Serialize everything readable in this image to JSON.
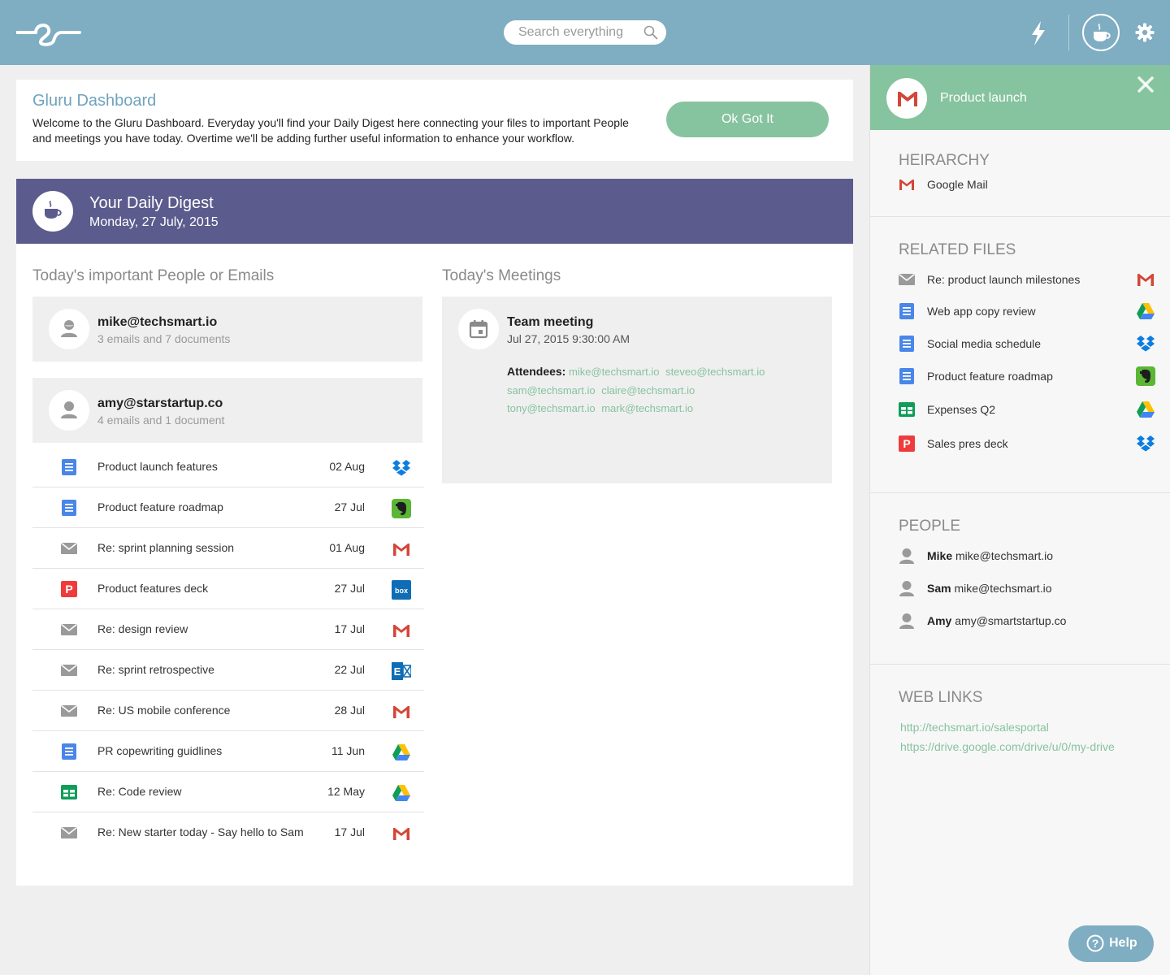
{
  "header": {
    "search_placeholder": "Search everything",
    "icons": [
      "logo-icon",
      "search-icon",
      "lightning-icon",
      "coffee-cup-icon",
      "gear-icon"
    ]
  },
  "welcome": {
    "title": "Gluru Dashboard",
    "text": "Welcome to the Gluru Dashboard. Everyday you'll find your Daily Digest here connecting your files to important People and meetings you have today. Overtime we'll be adding further useful information to enhance your workflow.",
    "button_label": "Ok Got It"
  },
  "digest": {
    "title": "Your Daily Digest",
    "date": "Monday, 27 July, 2015",
    "people_title": "Today's important People or Emails",
    "meetings_title": "Today's Meetings",
    "people": [
      {
        "email": "mike@techsmart.io",
        "summary": "3 emails and 7 documents"
      },
      {
        "email": "amy@starstartup.co",
        "summary": "4 emails and 1 document"
      }
    ],
    "files": [
      {
        "name": "Product launch features",
        "date": "02 Aug",
        "type": "doc",
        "source": "dropbox"
      },
      {
        "name": "Product feature roadmap",
        "date": "27 Jul",
        "type": "doc",
        "source": "evernote"
      },
      {
        "name": "Re: sprint planning session",
        "date": "01 Aug",
        "type": "mail",
        "source": "gmail"
      },
      {
        "name": "Product features deck",
        "date": "27 Jul",
        "type": "ppt",
        "source": "box"
      },
      {
        "name": "Re: design review",
        "date": "17 Jul",
        "type": "mail",
        "source": "gmail"
      },
      {
        "name": "Re: sprint retrospective",
        "date": "22 Jul",
        "type": "mail",
        "source": "exchange"
      },
      {
        "name": "Re: US mobile conference",
        "date": "28 Jul",
        "type": "mail",
        "source": "gmail"
      },
      {
        "name": "PR copewriting guidlines",
        "date": "11 Jun",
        "type": "doc",
        "source": "drive"
      },
      {
        "name": "Re: Code review",
        "date": "12 May",
        "type": "sheet",
        "source": "drive"
      },
      {
        "name": "Re: New starter today - Say hello to Sam",
        "date": "17 Jul",
        "type": "mail",
        "source": "gmail"
      }
    ],
    "meeting": {
      "title": "Team meeting",
      "time": "Jul 27, 2015 9:30:00 AM",
      "attendees_label": "Attendees:",
      "attendees": [
        "mike@techsmart.io",
        "steveo@techsmart.io",
        "sam@techsmart.io",
        "claire@techsmart.io",
        "tony@techsmart.io",
        "mark@techsmart.io"
      ]
    }
  },
  "panel": {
    "title": "Product launch",
    "hierarchy_title": "HEIRARCHY",
    "hierarchy_item": "Google Mail",
    "related_title": "RELATED FILES",
    "related": [
      {
        "name": "Re: product launch milestones",
        "type": "mail",
        "source": "gmail"
      },
      {
        "name": "Web app copy review",
        "type": "doc",
        "source": "drive"
      },
      {
        "name": "Social media schedule",
        "type": "doc",
        "source": "dropbox"
      },
      {
        "name": "Product feature roadmap",
        "type": "doc",
        "source": "evernote"
      },
      {
        "name": "Expenses Q2",
        "type": "sheet",
        "source": "drive"
      },
      {
        "name": "Sales pres deck",
        "type": "ppt",
        "source": "dropbox"
      }
    ],
    "people_title": "PEOPLE",
    "people": [
      {
        "name": "Mike",
        "email": "mike@techsmart.io"
      },
      {
        "name": "Sam",
        "email": "mike@techsmart.io"
      },
      {
        "name": "Amy",
        "email": "amy@smartstartup.co"
      }
    ],
    "links_title": "WEB LINKS",
    "links": [
      "http://techsmart.io/salesportal",
      "https://drive.google.com/drive/u/0/my-drive"
    ]
  },
  "help_label": "Help",
  "colors": {
    "topbar": "#7fadc2",
    "digest_header": "#5c5b8d",
    "accent_green": "#86c39f",
    "title_blue": "#6fa3bd"
  }
}
